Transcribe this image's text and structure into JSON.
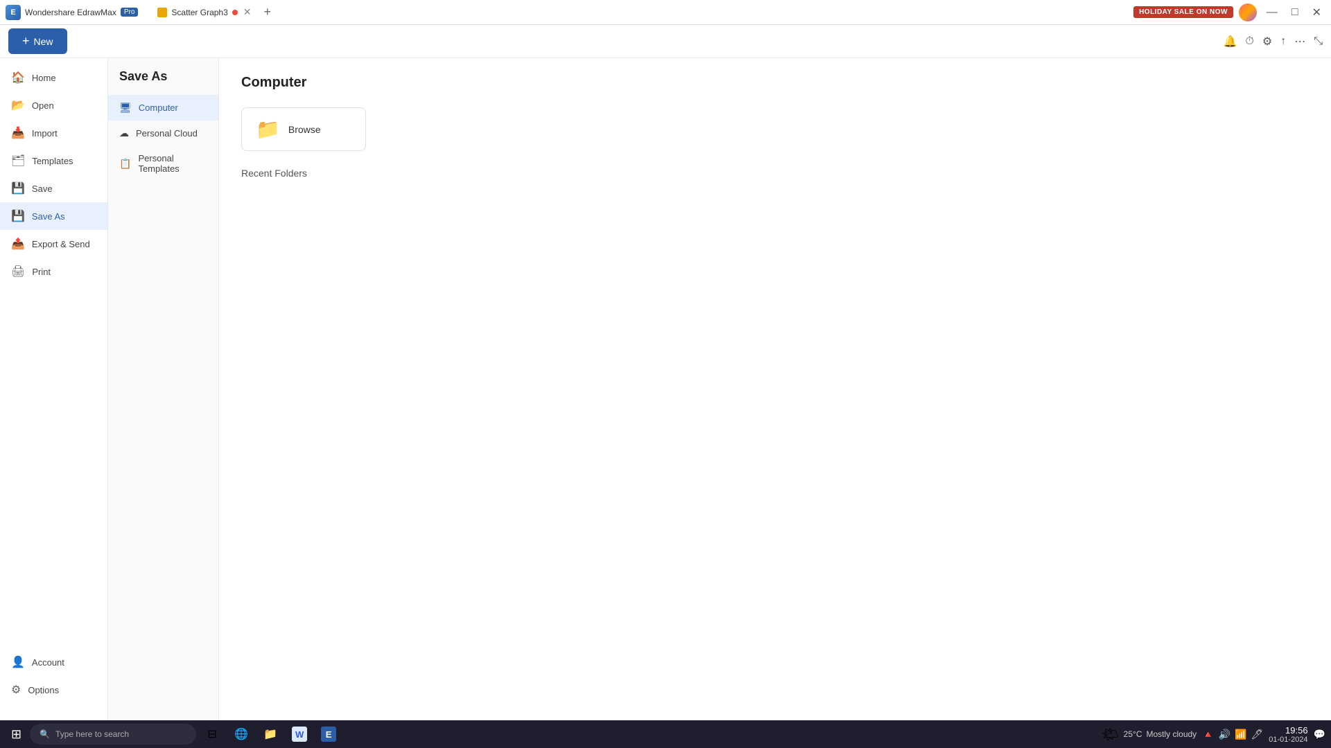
{
  "titlebar": {
    "app_name": "Wondershare EdrawMax",
    "pro_label": "Pro",
    "tabs": [
      {
        "label": "Scatter Graph3",
        "active": false,
        "has_dot": true
      }
    ],
    "holiday_btn": "HOLIDAY SALE ON NOW",
    "win_minimize": "—",
    "win_maximize": "□",
    "win_close": "✕"
  },
  "toolbar": {
    "new_label": "New",
    "new_plus": "+"
  },
  "sidebar": {
    "items": [
      {
        "id": "home",
        "label": "Home",
        "icon": "🏠"
      },
      {
        "id": "open",
        "label": "Open",
        "icon": "📂"
      },
      {
        "id": "import",
        "label": "Import",
        "icon": "📥"
      },
      {
        "id": "templates",
        "label": "Templates",
        "icon": "🗂"
      },
      {
        "id": "save",
        "label": "Save",
        "icon": "💾"
      },
      {
        "id": "save-as",
        "label": "Save As",
        "icon": "💾",
        "active": true
      },
      {
        "id": "export-send",
        "label": "Export & Send",
        "icon": "📤"
      },
      {
        "id": "print",
        "label": "Print",
        "icon": "🖨"
      }
    ],
    "bottom_items": [
      {
        "id": "account",
        "label": "Account",
        "icon": "👤"
      },
      {
        "id": "options",
        "label": "Options",
        "icon": "⚙"
      }
    ]
  },
  "middle_panel": {
    "title": "Save As",
    "items": [
      {
        "id": "computer",
        "label": "Computer",
        "icon": "🖥",
        "active": true
      },
      {
        "id": "personal-cloud",
        "label": "Personal Cloud",
        "icon": "☁"
      },
      {
        "id": "personal-templates",
        "label": "Personal Templates",
        "icon": "📋"
      }
    ]
  },
  "content": {
    "title": "Computer",
    "browse_label": "Browse",
    "recent_folders_label": "Recent Folders"
  },
  "taskbar": {
    "start_icon": "⊞",
    "search_placeholder": "Type here to search",
    "apps": [
      {
        "id": "taskview",
        "icon": "⊟"
      },
      {
        "id": "chrome",
        "icon": "🌐"
      },
      {
        "id": "files",
        "icon": "📁"
      },
      {
        "id": "word",
        "icon": "W"
      },
      {
        "id": "edraw",
        "icon": "E"
      }
    ],
    "weather": {
      "icon": "🌤",
      "temp": "25°C",
      "condition": "Mostly cloudy"
    },
    "time": "19:56",
    "date": "01-01-2024",
    "tray_icons": [
      "🔺",
      "🔊",
      "📶",
      "🖊"
    ]
  }
}
